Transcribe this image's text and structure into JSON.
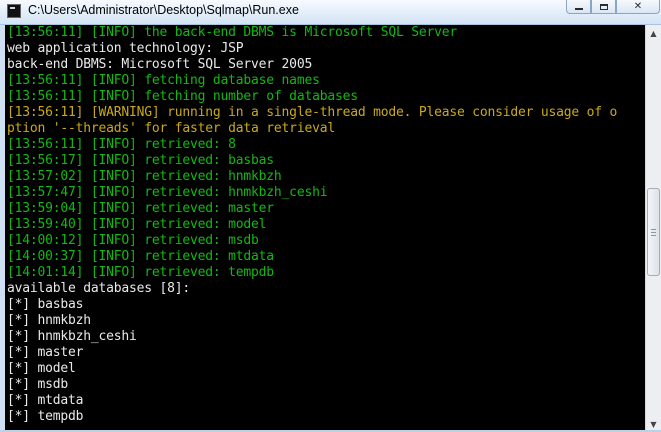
{
  "window": {
    "title": "C:\\Users\\Administrator\\Desktop\\Sqlmap\\Run.exe",
    "controls": {
      "minimize": "minimize",
      "maximize": "maximize",
      "close": "close"
    }
  },
  "console": {
    "lines": [
      {
        "text": "[13:56:11] [INFO] the back-end DBMS is Microsoft SQL Server",
        "color": "green"
      },
      {
        "text": "web application technology: JSP",
        "color": "white"
      },
      {
        "text": "back-end DBMS: Microsoft SQL Server 2005",
        "color": "white"
      },
      {
        "text": "[13:56:11] [INFO] fetching database names",
        "color": "green"
      },
      {
        "text": "[13:56:11] [INFO] fetching number of databases",
        "color": "green"
      },
      {
        "text": "[13:56:11] [WARNING] running in a single-thread mode. Please consider usage of o",
        "color": "yellow"
      },
      {
        "text": "ption '--threads' for faster data retrieval",
        "color": "yellow"
      },
      {
        "text": "[13:56:11] [INFO] retrieved: 8",
        "color": "green"
      },
      {
        "text": "[13:56:17] [INFO] retrieved: basbas",
        "color": "green"
      },
      {
        "text": "[13:57:02] [INFO] retrieved: hnmkbzh",
        "color": "green"
      },
      {
        "text": "[13:57:47] [INFO] retrieved: hnmkbzh_ceshi",
        "color": "green"
      },
      {
        "text": "[13:59:04] [INFO] retrieved: master",
        "color": "green"
      },
      {
        "text": "[13:59:40] [INFO] retrieved: model",
        "color": "green"
      },
      {
        "text": "[14:00:12] [INFO] retrieved: msdb",
        "color": "green"
      },
      {
        "text": "[14:00:37] [INFO] retrieved: mtdata",
        "color": "green"
      },
      {
        "text": "[14:01:14] [INFO] retrieved: tempdb",
        "color": "green"
      },
      {
        "text": "available databases [8]:",
        "color": "white"
      },
      {
        "text": "[*] basbas",
        "color": "white"
      },
      {
        "text": "[*] hnmkbzh",
        "color": "white"
      },
      {
        "text": "[*] hnmkbzh_ceshi",
        "color": "white"
      },
      {
        "text": "[*] master",
        "color": "white"
      },
      {
        "text": "[*] model",
        "color": "white"
      },
      {
        "text": "[*] msdb",
        "color": "white"
      },
      {
        "text": "[*] mtdata",
        "color": "white"
      },
      {
        "text": "[*] tempdb",
        "color": "white"
      }
    ]
  },
  "colors": {
    "green": "#12b812",
    "white": "#e9e9e9",
    "yellow": "#c9a919",
    "background": "#000000"
  },
  "scrollbar": {
    "up_icon": "arrow-up-icon",
    "down_icon": "arrow-down-icon"
  }
}
